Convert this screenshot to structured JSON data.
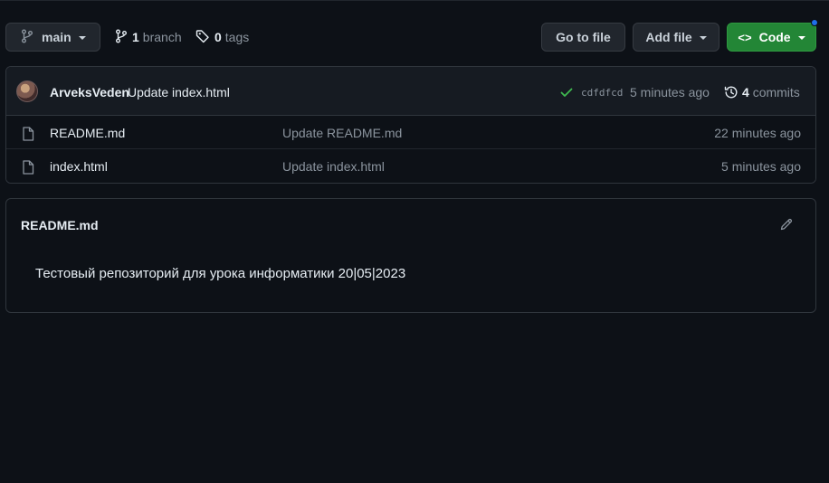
{
  "toolbar": {
    "branch_name": "main",
    "branches_count": "1",
    "branches_label": "branch",
    "tags_count": "0",
    "tags_label": "tags",
    "goto_file_label": "Go to file",
    "add_file_label": "Add file",
    "code_label": "Code"
  },
  "commit": {
    "author": "ArveksVeden",
    "message": "Update index.html",
    "sha": "cdfdfcd",
    "time": "5 minutes ago",
    "commits_count": "4",
    "commits_label": "commits"
  },
  "files": [
    {
      "name": "README.md",
      "message": "Update README.md",
      "time": "22 minutes ago"
    },
    {
      "name": "index.html",
      "message": "Update index.html",
      "time": "5 minutes ago"
    }
  ],
  "readme": {
    "title": "README.md",
    "content": "Тестовый репозиторий для урока информатики 20|05|2023"
  },
  "colors": {
    "background": "#0d1117",
    "code_button": "#238636",
    "success_check": "#3fb950",
    "notification_dot": "#1f6feb"
  },
  "icons": [
    "branch-icon",
    "tag-icon",
    "check-icon",
    "history-icon",
    "file-icon",
    "pencil-icon",
    "code-icon"
  ]
}
